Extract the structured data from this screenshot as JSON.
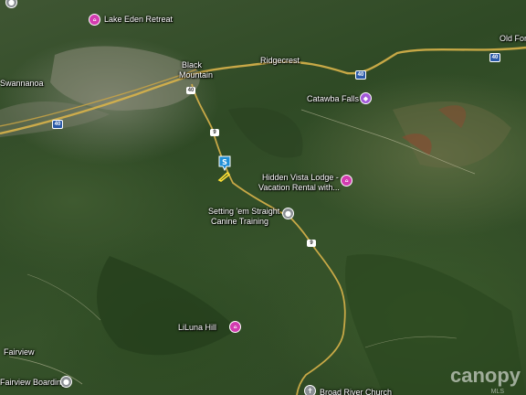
{
  "places": {
    "lake_eden_retreat": "Lake Eden Retreat",
    "black_mountain_line1": "Black",
    "black_mountain_line2": "Mountain",
    "ridgecrest": "Ridgecrest",
    "old_fort": "Old Fort",
    "swannanoa": "Swannanoa",
    "catawba_falls": "Catawba Falls",
    "hidden_vista_line1": "Hidden Vista Lodge -",
    "hidden_vista_line2": "Vacation Rental with...",
    "setting_em_line1": "Setting 'em Straight",
    "setting_em_line2": "Canine Training",
    "liluna_hill": "LiLuna Hill",
    "fairview": "Fairview",
    "fairview_boarding": "Fairview Boarding",
    "broad_river_church": "Broad River Church"
  },
  "route_shields": {
    "i40_a": "40",
    "i40_b": "40",
    "i40_c": "40",
    "nc9_a": "9",
    "nc9_b": "9",
    "hwy_junction": "40"
  },
  "subject_marker": {
    "letter": "S"
  },
  "poi_glyphs": {
    "hotel": "⌂",
    "park": "◆",
    "place": "●",
    "church": "✝"
  },
  "watermark": {
    "brand": "canopy",
    "sub": "MLS"
  },
  "colors": {
    "poi_lodging": "#d33cb0",
    "poi_park": "#a35ad8",
    "poi_generic": "#8a8e93",
    "road": "#d8b24a",
    "subject_pin": "#1f8fd6"
  }
}
